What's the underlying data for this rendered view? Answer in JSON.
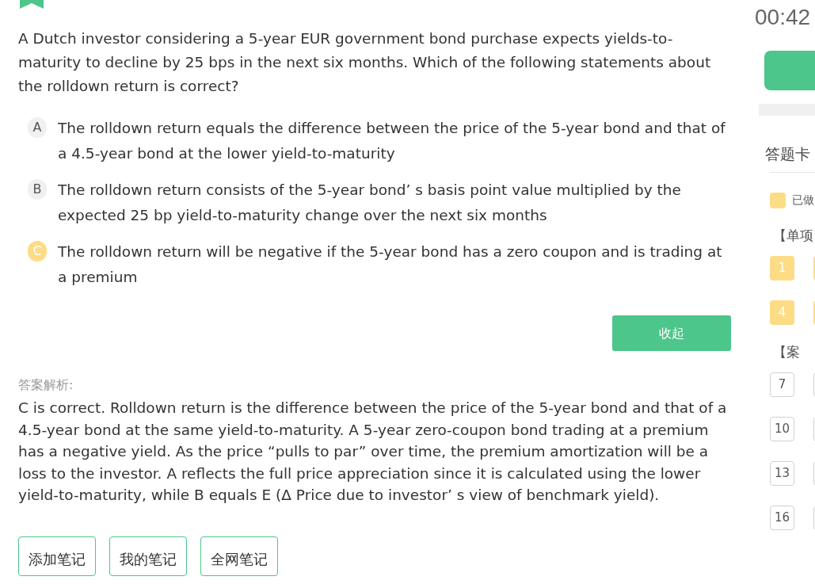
{
  "question": {
    "text": "A Dutch investor considering a 5-year EUR government bond purchase expects yields-to-maturity to decline by 25 bps in the next six months. Which of the following statements about the rolldown return is correct?",
    "options": [
      {
        "letter": "A",
        "text": "The rolldown return equals the difference between the price of the 5-year bond and that of a 4.5-year bond at the lower yield-to-maturity",
        "selected": false
      },
      {
        "letter": "B",
        "text": "The rolldown return consists of the 5-year bond’ s basis point value multiplied by the expected 25 bp yield-to-maturity change over the next six months",
        "selected": false
      },
      {
        "letter": "C",
        "text": "The rolldown return will be negative if the 5-year bond has a zero coupon and is trading at a premium",
        "selected": true
      }
    ]
  },
  "collapse_button": "收起",
  "analysis": {
    "label": "答案解析:",
    "text": "C is correct. Rolldown return is the difference between the price of the 5-year bond and that of a 4.5-year bond at the same yield-to-maturity. A 5-year zero-coupon bond trading at a premium has a negative yield. As the price “pulls to par” over time, the premium amortization will be a loss to the investor. A reflects the full price appreciation since it is calculated using the lower yield-to-maturity, while B equals E (Δ Price due to investor’ s view of benchmark yield)."
  },
  "note_buttons": [
    "添加笔记",
    "我的笔记",
    "全网笔记"
  ],
  "sidebar": {
    "timer": "00:42",
    "card_title": "答题卡",
    "legend": "已做",
    "sections": [
      {
        "title": "【单项",
        "rows": [
          [
            {
              "number": "1",
              "done": true
            },
            {
              "done": true
            }
          ],
          [
            {
              "number": "4",
              "done": true
            },
            {
              "done": true
            }
          ]
        ]
      },
      {
        "title": "【案",
        "rows": [
          [
            {
              "number": "7",
              "done": false
            },
            {
              "done": false
            }
          ],
          [
            {
              "number": "10",
              "done": false
            },
            {
              "done": false
            }
          ],
          [
            {
              "number": "13",
              "done": false
            },
            {
              "done": false
            }
          ],
          [
            {
              "number": "16",
              "done": false
            },
            {
              "done": false
            }
          ]
        ]
      }
    ]
  }
}
